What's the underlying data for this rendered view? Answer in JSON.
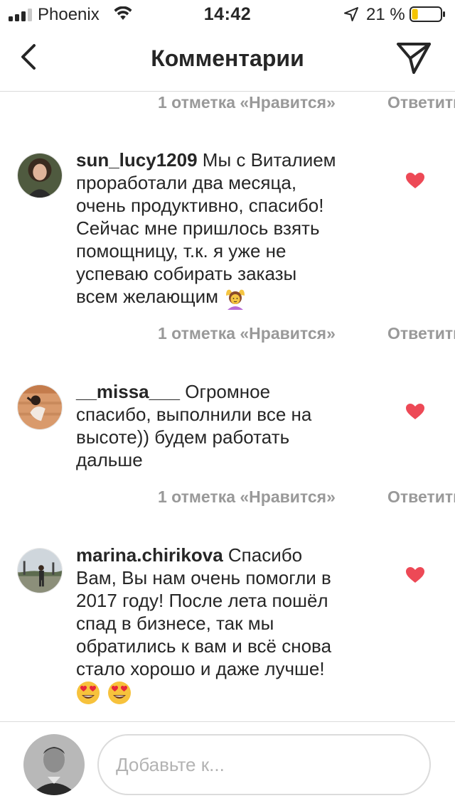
{
  "status_bar": {
    "carrier": "Phoenix",
    "time": "14:42",
    "battery_percent": "21 %",
    "battery_level": 0.21,
    "battery_color": "#f5c400",
    "icons": [
      "signal-bars-icon",
      "wifi-icon",
      "location-arrow-icon",
      "battery-icon"
    ]
  },
  "nav": {
    "title": "Комментарии",
    "back_icon": "chevron-left-icon",
    "share_icon": "paper-plane-icon"
  },
  "colors": {
    "text": "#262626",
    "meta": "#999999",
    "heart": "#ed4956",
    "divider": "#dbdbdb"
  },
  "comments": [
    {
      "likes_label": "1 отметка «Нравится»",
      "reply_label": "Ответить"
    },
    {
      "username": "sun_lucy1209",
      "text_lines": [
        " Мы с Виталием",
        "проработали два месяца,",
        "очень продуктивно, спасибо!",
        "Сейчас мне пришлось взять",
        "помощницу, т.к. я уже не",
        "успеваю собирать заказы",
        "всем желающим "
      ],
      "emoji": [
        "woman-gesturing-ok-emoji"
      ],
      "liked": true,
      "likes_label": "1 отметка «Нравится»",
      "reply_label": "Ответить"
    },
    {
      "username": "__missa___",
      "text_lines": [
        " Огромное",
        "спасибо, выполнили все на",
        "высоте)) будем работать",
        "дальше"
      ],
      "liked": true,
      "likes_label": "1 отметка «Нравится»",
      "reply_label": "Ответить"
    },
    {
      "username": "marina.chirikova",
      "text_lines": [
        " Спасибо",
        "Вам, Вы нам очень помогли в",
        "2017 году! После лета пошёл",
        "спад в бизнесе, так мы",
        "обратились к вам и всё снова",
        "стало хорошо и даже лучше!"
      ],
      "emoji": [
        "heart-eyes-emoji",
        "heart-eyes-emoji"
      ],
      "liked": true
    }
  ],
  "composer": {
    "placeholder": "Добавьте к..."
  }
}
